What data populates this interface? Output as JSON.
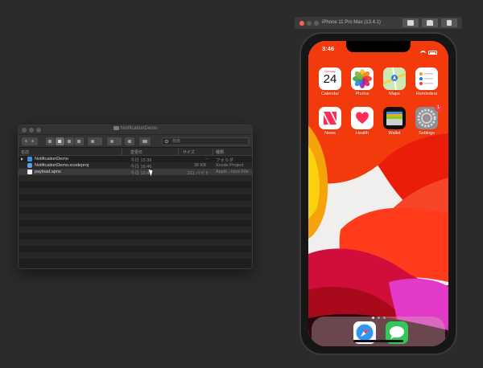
{
  "finder": {
    "title": "NotificationDemo",
    "search_placeholder": "検索",
    "columns": {
      "name": "名前",
      "date": "変更日",
      "size": "サイズ",
      "kind": "種類"
    },
    "rows": [
      {
        "name": "NotificationDemo",
        "date": "今日 15:38",
        "size": "--",
        "kind": "フォルダ",
        "icon": "folder-icon"
      },
      {
        "name": "NotificationDemo.xcodeproj",
        "date": "今日 16:46",
        "size": "38 KB",
        "kind": "Xcode Project",
        "icon": "xcode-project-icon"
      },
      {
        "name": "payload.apns",
        "date": "今日 16:45",
        "size": "211 バイト",
        "kind": "Apple...rvice File",
        "icon": "document-icon"
      }
    ]
  },
  "simulator": {
    "title": "iPhone 11 Pro Max (13.4.1)",
    "buttons": [
      "screenshot-icon",
      "home-icon",
      "rotate-icon"
    ]
  },
  "phone": {
    "time": "3:46",
    "apps": [
      {
        "label": "Calendar",
        "icon": "calendar-icon",
        "weekday": "Sunday",
        "day": "24"
      },
      {
        "label": "Photos",
        "icon": "photos-icon"
      },
      {
        "label": "Maps",
        "icon": "maps-icon"
      },
      {
        "label": "Reminders",
        "icon": "reminders-icon"
      },
      {
        "label": "News",
        "icon": "news-icon"
      },
      {
        "label": "Health",
        "icon": "health-icon"
      },
      {
        "label": "Wallet",
        "icon": "wallet-icon"
      },
      {
        "label": "Settings",
        "icon": "settings-icon",
        "badge": "1"
      }
    ],
    "dock": [
      {
        "icon": "safari-icon"
      },
      {
        "icon": "messages-icon"
      }
    ],
    "page_count": 3,
    "current_page": 1
  },
  "colors": {
    "desktop": "#2b2b2b",
    "accent_blue": "#3d8ede",
    "wallpaper_red": "#e8170c",
    "badge_red": "#ff3b30"
  }
}
